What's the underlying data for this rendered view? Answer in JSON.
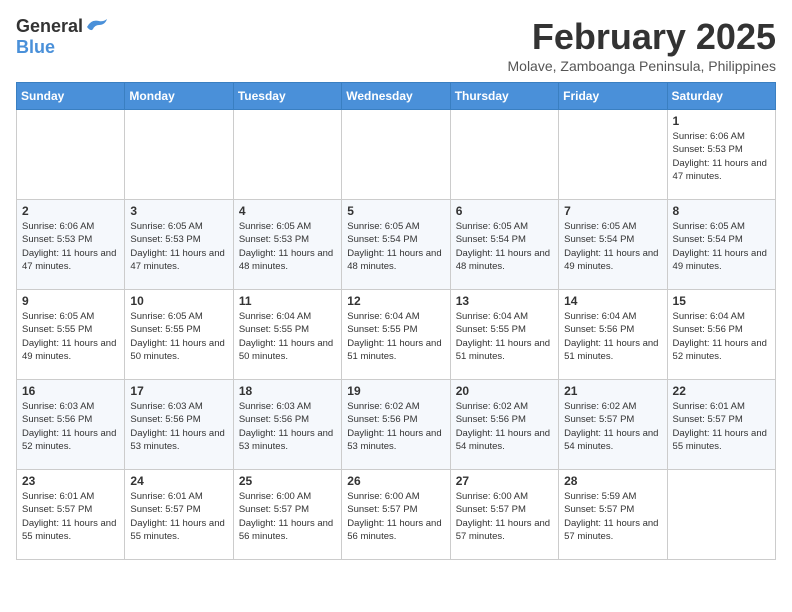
{
  "header": {
    "logo_general": "General",
    "logo_blue": "Blue",
    "month_title": "February 2025",
    "location": "Molave, Zamboanga Peninsula, Philippines"
  },
  "weekdays": [
    "Sunday",
    "Monday",
    "Tuesday",
    "Wednesday",
    "Thursday",
    "Friday",
    "Saturday"
  ],
  "weeks": [
    [
      {
        "day": "",
        "info": ""
      },
      {
        "day": "",
        "info": ""
      },
      {
        "day": "",
        "info": ""
      },
      {
        "day": "",
        "info": ""
      },
      {
        "day": "",
        "info": ""
      },
      {
        "day": "",
        "info": ""
      },
      {
        "day": "1",
        "info": "Sunrise: 6:06 AM\nSunset: 5:53 PM\nDaylight: 11 hours and 47 minutes."
      }
    ],
    [
      {
        "day": "2",
        "info": "Sunrise: 6:06 AM\nSunset: 5:53 PM\nDaylight: 11 hours and 47 minutes."
      },
      {
        "day": "3",
        "info": "Sunrise: 6:05 AM\nSunset: 5:53 PM\nDaylight: 11 hours and 47 minutes."
      },
      {
        "day": "4",
        "info": "Sunrise: 6:05 AM\nSunset: 5:53 PM\nDaylight: 11 hours and 48 minutes."
      },
      {
        "day": "5",
        "info": "Sunrise: 6:05 AM\nSunset: 5:54 PM\nDaylight: 11 hours and 48 minutes."
      },
      {
        "day": "6",
        "info": "Sunrise: 6:05 AM\nSunset: 5:54 PM\nDaylight: 11 hours and 48 minutes."
      },
      {
        "day": "7",
        "info": "Sunrise: 6:05 AM\nSunset: 5:54 PM\nDaylight: 11 hours and 49 minutes."
      },
      {
        "day": "8",
        "info": "Sunrise: 6:05 AM\nSunset: 5:54 PM\nDaylight: 11 hours and 49 minutes."
      }
    ],
    [
      {
        "day": "9",
        "info": "Sunrise: 6:05 AM\nSunset: 5:55 PM\nDaylight: 11 hours and 49 minutes."
      },
      {
        "day": "10",
        "info": "Sunrise: 6:05 AM\nSunset: 5:55 PM\nDaylight: 11 hours and 50 minutes."
      },
      {
        "day": "11",
        "info": "Sunrise: 6:04 AM\nSunset: 5:55 PM\nDaylight: 11 hours and 50 minutes."
      },
      {
        "day": "12",
        "info": "Sunrise: 6:04 AM\nSunset: 5:55 PM\nDaylight: 11 hours and 51 minutes."
      },
      {
        "day": "13",
        "info": "Sunrise: 6:04 AM\nSunset: 5:55 PM\nDaylight: 11 hours and 51 minutes."
      },
      {
        "day": "14",
        "info": "Sunrise: 6:04 AM\nSunset: 5:56 PM\nDaylight: 11 hours and 51 minutes."
      },
      {
        "day": "15",
        "info": "Sunrise: 6:04 AM\nSunset: 5:56 PM\nDaylight: 11 hours and 52 minutes."
      }
    ],
    [
      {
        "day": "16",
        "info": "Sunrise: 6:03 AM\nSunset: 5:56 PM\nDaylight: 11 hours and 52 minutes."
      },
      {
        "day": "17",
        "info": "Sunrise: 6:03 AM\nSunset: 5:56 PM\nDaylight: 11 hours and 53 minutes."
      },
      {
        "day": "18",
        "info": "Sunrise: 6:03 AM\nSunset: 5:56 PM\nDaylight: 11 hours and 53 minutes."
      },
      {
        "day": "19",
        "info": "Sunrise: 6:02 AM\nSunset: 5:56 PM\nDaylight: 11 hours and 53 minutes."
      },
      {
        "day": "20",
        "info": "Sunrise: 6:02 AM\nSunset: 5:56 PM\nDaylight: 11 hours and 54 minutes."
      },
      {
        "day": "21",
        "info": "Sunrise: 6:02 AM\nSunset: 5:57 PM\nDaylight: 11 hours and 54 minutes."
      },
      {
        "day": "22",
        "info": "Sunrise: 6:01 AM\nSunset: 5:57 PM\nDaylight: 11 hours and 55 minutes."
      }
    ],
    [
      {
        "day": "23",
        "info": "Sunrise: 6:01 AM\nSunset: 5:57 PM\nDaylight: 11 hours and 55 minutes."
      },
      {
        "day": "24",
        "info": "Sunrise: 6:01 AM\nSunset: 5:57 PM\nDaylight: 11 hours and 55 minutes."
      },
      {
        "day": "25",
        "info": "Sunrise: 6:00 AM\nSunset: 5:57 PM\nDaylight: 11 hours and 56 minutes."
      },
      {
        "day": "26",
        "info": "Sunrise: 6:00 AM\nSunset: 5:57 PM\nDaylight: 11 hours and 56 minutes."
      },
      {
        "day": "27",
        "info": "Sunrise: 6:00 AM\nSunset: 5:57 PM\nDaylight: 11 hours and 57 minutes."
      },
      {
        "day": "28",
        "info": "Sunrise: 5:59 AM\nSunset: 5:57 PM\nDaylight: 11 hours and 57 minutes."
      },
      {
        "day": "",
        "info": ""
      }
    ]
  ]
}
